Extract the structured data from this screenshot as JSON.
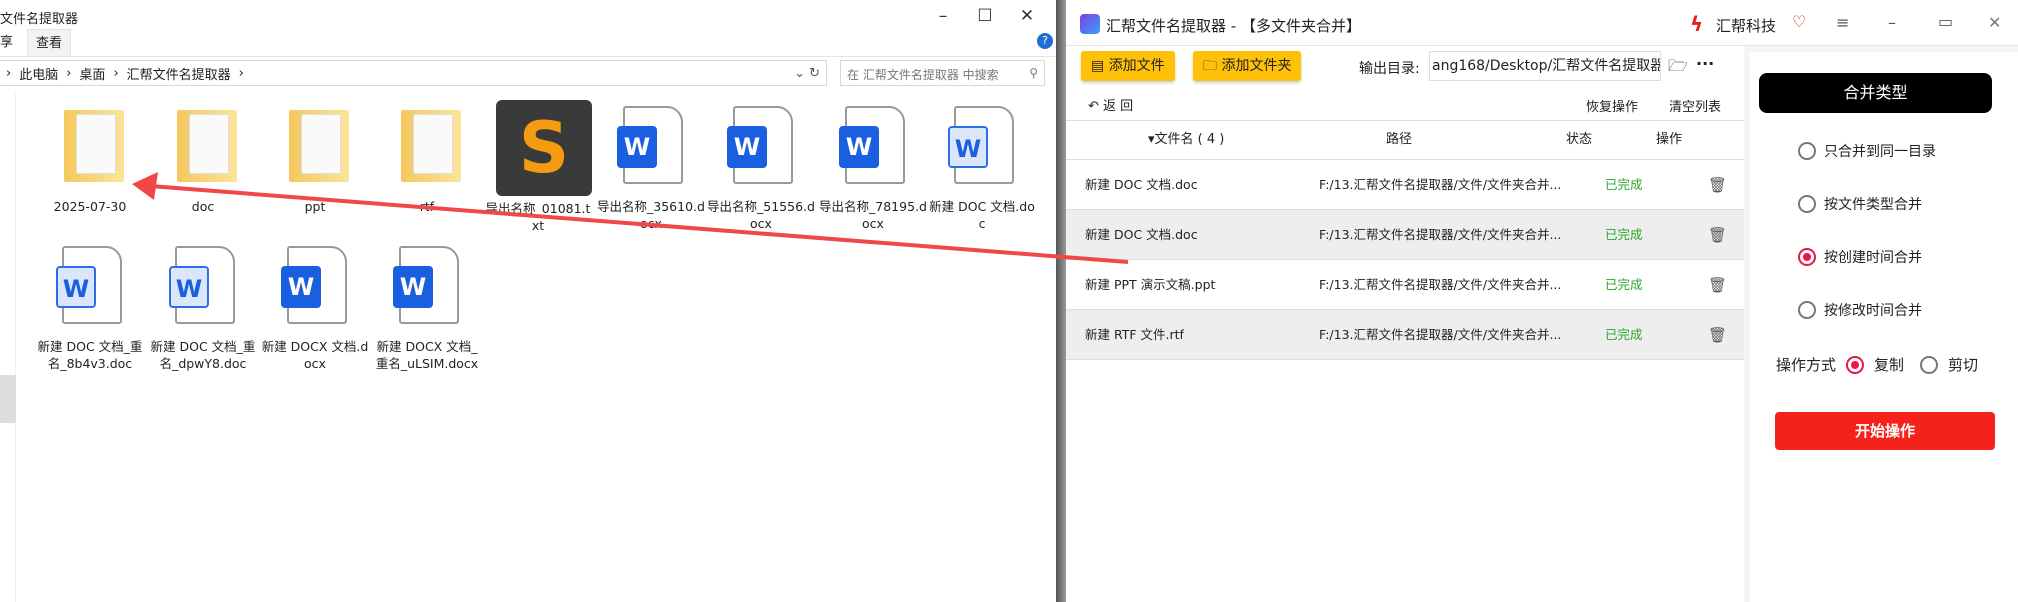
{
  "explorer": {
    "title": "文件名提取器",
    "ribbon_tabs": [
      "享",
      "查看"
    ],
    "breadcrumb": [
      "此电脑",
      "桌面",
      "汇帮文件名提取器"
    ],
    "search_placeholder": "在 汇帮文件名提取器 中搜索",
    "items": [
      {
        "name": "2025-07-30",
        "type": "folder"
      },
      {
        "name": "doc",
        "type": "folder"
      },
      {
        "name": "ppt",
        "type": "folder"
      },
      {
        "name": "rtf",
        "type": "folder"
      },
      {
        "name": "导出名称_01081.txt",
        "type": "txt"
      },
      {
        "name": "导出名称_35610.docx",
        "type": "docx"
      },
      {
        "name": "导出名称_51556.docx",
        "type": "docx"
      },
      {
        "name": "导出名称_78195.docx",
        "type": "docx"
      },
      {
        "name": "新建 DOC 文档.doc",
        "type": "doc"
      },
      {
        "name": "新建 DOC 文档_重名_8b4v3.doc",
        "type": "doc"
      },
      {
        "name": "新建 DOC 文档_重名_dpwY8.doc",
        "type": "doc"
      },
      {
        "name": "新建 DOCX 文档.docx",
        "type": "docx"
      },
      {
        "name": "新建 DOCX 文档_重名_uLSIM.docx",
        "type": "docx"
      }
    ]
  },
  "app": {
    "title": "汇帮文件名提取器 - 【多文件夹合并】",
    "brand": "汇帮科技",
    "add_file": "添加文件",
    "add_folder": "添加文件夹",
    "output_label": "输出目录:",
    "output_value": "ang168/Desktop/汇帮文件名提取器",
    "back": "返 回",
    "restore": "恢复操作",
    "clear": "清空列表",
    "columns": {
      "name": "文件名 ( 4 )",
      "path": "路径",
      "status": "状态",
      "op": "操作"
    },
    "rows": [
      {
        "name": "新建 DOC 文档.doc",
        "path": "F:/13.汇帮文件名提取器/文件/文件夹合并...",
        "status": "已完成"
      },
      {
        "name": "新建 DOC 文档.doc",
        "path": "F:/13.汇帮文件名提取器/文件/文件夹合并...",
        "status": "已完成"
      },
      {
        "name": "新建 PPT 演示文稿.ppt",
        "path": "F:/13.汇帮文件名提取器/文件/文件夹合并...",
        "status": "已完成"
      },
      {
        "name": "新建 RTF 文件.rtf",
        "path": "F:/13.汇帮文件名提取器/文件/文件夹合并...",
        "status": "已完成"
      }
    ],
    "merge_type_title": "合并类型",
    "merge_options": [
      "只合并到同一目录",
      "按文件类型合并",
      "按创建时间合并",
      "按修改时间合并"
    ],
    "merge_selected": 2,
    "op_mode_label": "操作方式",
    "op_modes": [
      "复制",
      "剪切"
    ],
    "op_selected": 0,
    "start": "开始操作",
    "colors": {
      "accent_yellow": "#ffc107",
      "start_red": "#f5221b",
      "done_green": "#2ba52b",
      "radio_red": "#e8174a"
    }
  }
}
